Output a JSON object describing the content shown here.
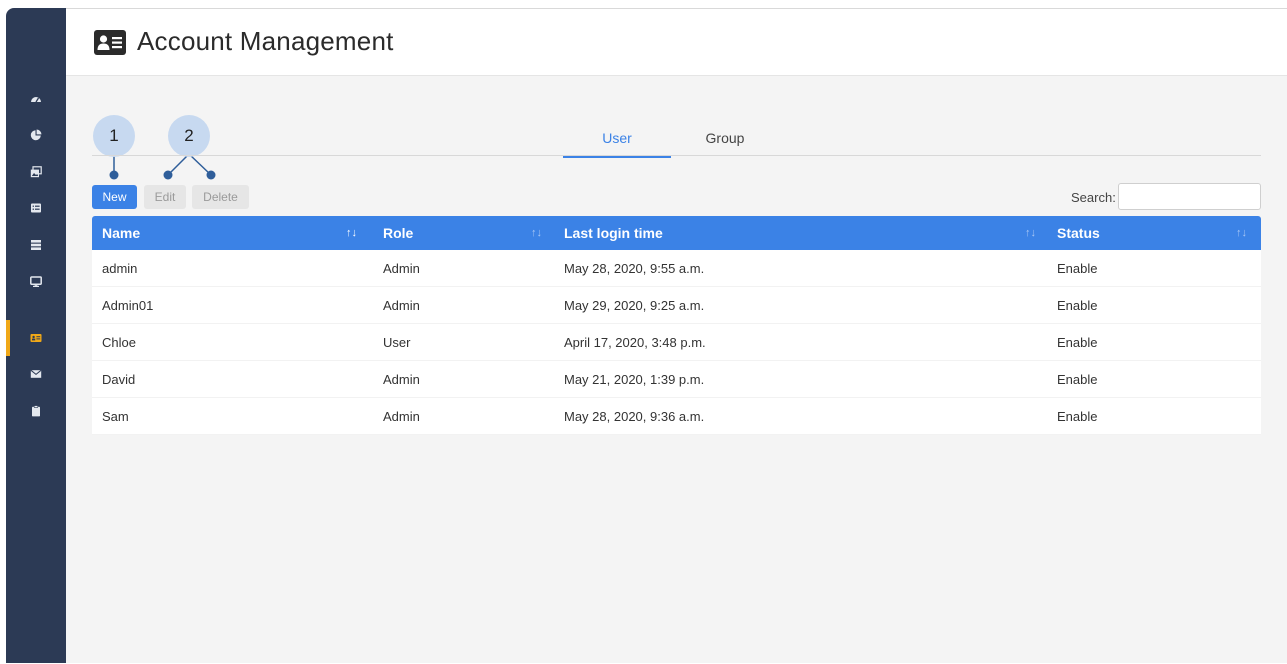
{
  "page": {
    "title": "Account Management",
    "icon": "id-card-icon"
  },
  "sidebar": {
    "items": [
      {
        "icon": "dashboard-icon",
        "active": false
      },
      {
        "icon": "pie-chart-icon",
        "active": false
      },
      {
        "icon": "images-icon",
        "active": false
      },
      {
        "icon": "list-icon",
        "active": false
      },
      {
        "icon": "server-icon",
        "active": false
      },
      {
        "icon": "monitor-icon",
        "active": false
      },
      {
        "icon": "id-card-icon",
        "active": true
      },
      {
        "icon": "envelope-icon",
        "active": false
      },
      {
        "icon": "clipboard-icon",
        "active": false
      }
    ],
    "accent_color": "#f0a818"
  },
  "tabs": [
    {
      "label": "User",
      "active": true
    },
    {
      "label": "Group",
      "active": false
    }
  ],
  "toolbar": {
    "new_label": "New",
    "edit_label": "Edit",
    "delete_label": "Delete",
    "search_label": "Search:",
    "search_value": ""
  },
  "callouts": {
    "one": "1",
    "two": "2"
  },
  "table": {
    "columns": [
      "Name",
      "Role",
      "Last login time",
      "Status"
    ],
    "sort_indicators": [
      "↑↓",
      "↑↓",
      "↑↓",
      "↑↓"
    ],
    "rows": [
      {
        "name": "admin",
        "role": "Admin",
        "last_login": "May 28, 2020, 9:55 a.m.",
        "status": "Enable"
      },
      {
        "name": "Admin01",
        "role": "Admin",
        "last_login": "May 29, 2020, 9:25 a.m.",
        "status": "Enable"
      },
      {
        "name": "Chloe",
        "role": "User",
        "last_login": "April 17, 2020, 3:48 p.m.",
        "status": "Enable"
      },
      {
        "name": "David",
        "role": "Admin",
        "last_login": "May 21, 2020, 1:39 p.m.",
        "status": "Enable"
      },
      {
        "name": "Sam",
        "role": "Admin",
        "last_login": "May 28, 2020, 9:36 a.m.",
        "status": "Enable"
      }
    ]
  },
  "colors": {
    "primary": "#3b82e6",
    "sidebar": "#2c3a55",
    "callout": "#c7d9f0"
  }
}
